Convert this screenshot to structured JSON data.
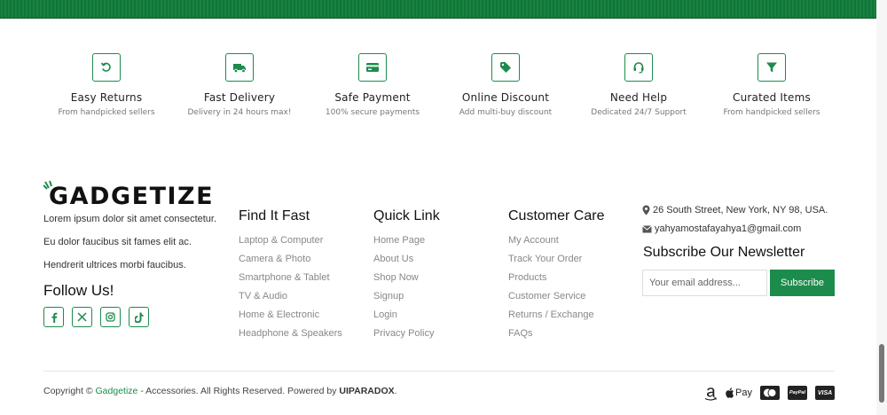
{
  "features": [
    {
      "icon": "return-icon",
      "title": "Easy Returns",
      "subtitle": "From handpicked sellers"
    },
    {
      "icon": "truck-icon",
      "title": "Fast Delivery",
      "subtitle": "Delivery in 24 hours max!"
    },
    {
      "icon": "credit-card-icon",
      "title": "Safe Payment",
      "subtitle": "100% secure payments"
    },
    {
      "icon": "tag-icon",
      "title": "Online Discount",
      "subtitle": "Add multi-buy discount"
    },
    {
      "icon": "headset-icon",
      "title": "Need Help",
      "subtitle": "Dedicated 24/7 Support"
    },
    {
      "icon": "filter-icon",
      "title": "Curated Items",
      "subtitle": "From handpicked sellers"
    }
  ],
  "brand": {
    "logo_text": "GADGETIZE",
    "lines": [
      "Lorem ipsum dolor sit amet consectetur.",
      "Eu dolor faucibus sit fames elit ac.",
      "Hendrerit ultrices morbi faucibus."
    ],
    "follow_title": "Follow Us!"
  },
  "socials": [
    "facebook-icon",
    "x-icon",
    "instagram-icon",
    "tiktok-icon"
  ],
  "columns": [
    {
      "title": "Find It Fast",
      "links": [
        "Laptop & Computer",
        "Camera & Photo",
        "Smartphone & Tablet",
        "TV & Audio",
        "Home & Electronic",
        "Headphone & Speakers"
      ]
    },
    {
      "title": "Quick Link",
      "links": [
        "Home Page",
        "About Us",
        "Shop Now",
        "Signup",
        "Login",
        "Privacy Policy"
      ]
    },
    {
      "title": "Customer Care",
      "links": [
        "My Account",
        "Track Your Order",
        "Products",
        "Customer Service",
        "Returns / Exchange",
        "FAQs"
      ]
    }
  ],
  "contact": {
    "address": "26 South Street, New York, NY 98, USA.",
    "email": "yahyamostafayahya1@gmail.com"
  },
  "newsletter": {
    "title": "Subscribe Our Newsletter",
    "placeholder": "Your email address...",
    "button": "Subscribe"
  },
  "footer": {
    "copyright_prefix": "Copyright ©",
    "brand": "Gadgetize",
    "middle": "- Accessories. All Rights Reserved. Powered by",
    "powered_by": "UIPARADOX",
    "suffix": "."
  },
  "payments": {
    "icons": [
      "amazon-icon",
      "apple-pay-icon",
      "mastercard-icon",
      "paypal-icon",
      "visa-icon"
    ],
    "applepay_label": "Pay",
    "paypal_label": "PayPal",
    "visa_label": "VISA"
  },
  "colors": {
    "accent": "#1c8c4d",
    "band": "#0e6e32"
  }
}
